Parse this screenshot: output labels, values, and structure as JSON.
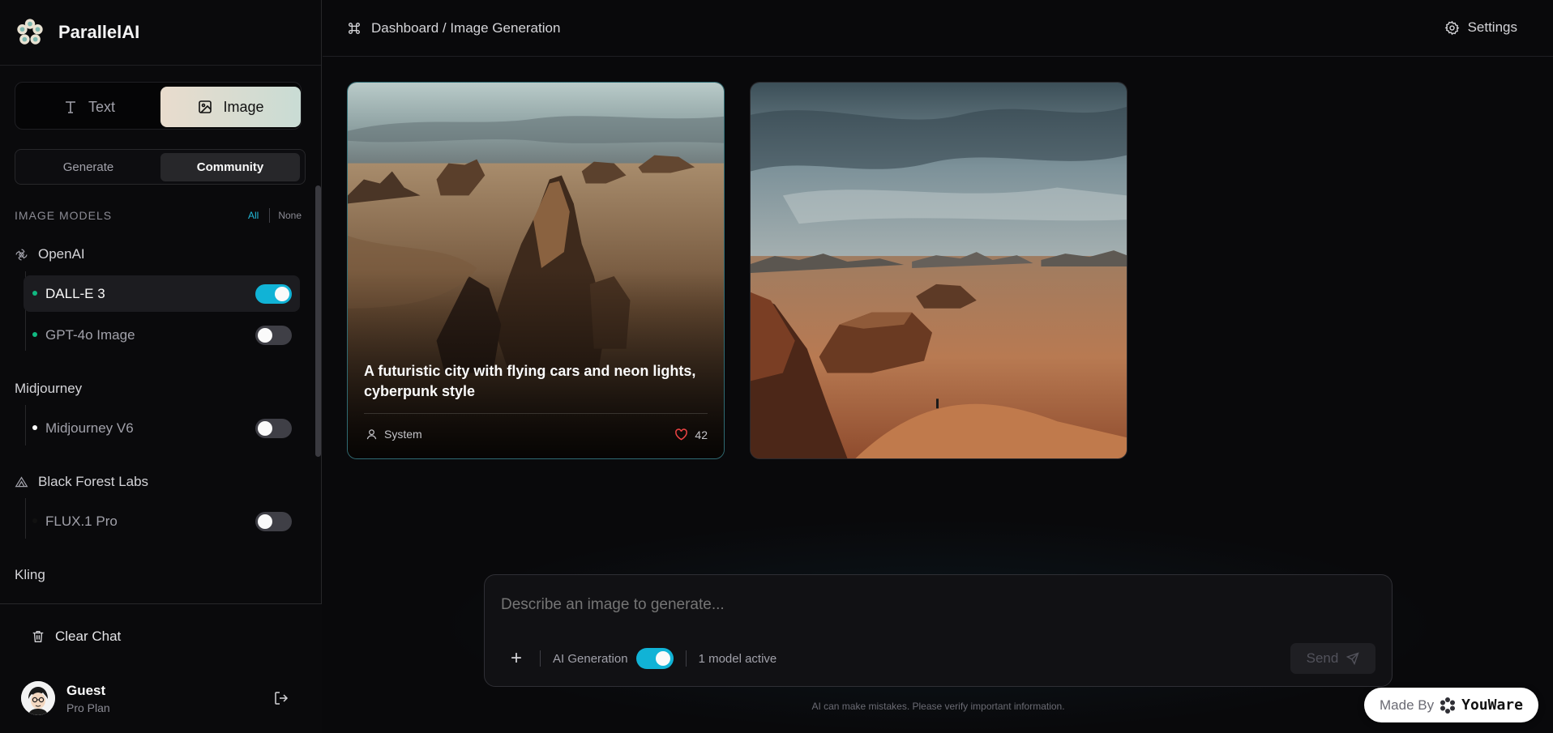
{
  "app": {
    "name": "ParallelAI"
  },
  "mode": {
    "text_label": "Text",
    "image_label": "Image",
    "selected": "Image"
  },
  "subtabs": {
    "generate_label": "Generate",
    "community_label": "Community",
    "selected": "Community"
  },
  "models": {
    "title": "IMAGE MODELS",
    "all_label": "All",
    "none_label": "None",
    "providers": [
      {
        "name": "OpenAI",
        "icon": "openai-icon",
        "items": [
          {
            "label": "DALL-E 3",
            "enabled": true,
            "dot_color": "#10b981"
          },
          {
            "label": "GPT-4o Image",
            "enabled": false,
            "dot_color": "#10b981"
          }
        ]
      },
      {
        "name": "Midjourney",
        "icon": "",
        "items": [
          {
            "label": "Midjourney V6",
            "enabled": false,
            "dot_color": "#ffffff"
          }
        ]
      },
      {
        "name": "Black Forest Labs",
        "icon": "triangle-icon",
        "items": [
          {
            "label": "FLUX.1 Pro",
            "enabled": false,
            "dot_color": "#111111"
          }
        ]
      },
      {
        "name": "Kling",
        "icon": "",
        "items": []
      }
    ]
  },
  "sidebar_footer": {
    "clear_chat_label": "Clear Chat",
    "user_name": "Guest",
    "user_plan": "Pro Plan"
  },
  "topbar": {
    "breadcrumb": "Dashboard / Image Generation",
    "settings_label": "Settings"
  },
  "gallery": [
    {
      "caption": "A futuristic city with flying cars and neon lights, cyberpunk style",
      "author": "System",
      "likes": "42",
      "hovered": true
    },
    {
      "caption": "",
      "author": "",
      "likes": "",
      "hovered": false
    }
  ],
  "composer": {
    "placeholder": "Describe an image to generate...",
    "ai_generation_label": "AI Generation",
    "ai_generation_enabled": true,
    "active_models_label": "1 model active",
    "send_label": "Send",
    "disclaimer": "AI can make mistakes. Please verify important information."
  },
  "badge": {
    "made_by_label": "Made By",
    "brand": "YouWare"
  },
  "colors": {
    "accent": "#11b3d6",
    "background": "#09090b",
    "sidebar": "#0a0a0c",
    "like": "#ef4444"
  }
}
